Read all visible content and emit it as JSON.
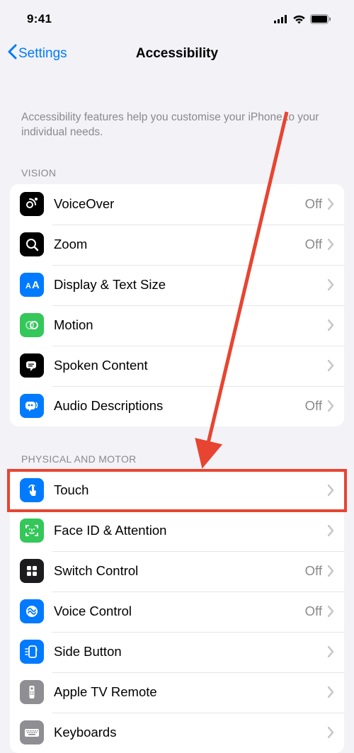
{
  "status": {
    "time": "9:41"
  },
  "nav": {
    "back_label": "Settings",
    "title": "Accessibility"
  },
  "intro": "Accessibility features help you customise your iPhone to your individual needs.",
  "sections": {
    "vision": {
      "header": "VISION",
      "items": [
        {
          "label": "VoiceOver",
          "value": "Off"
        },
        {
          "label": "Zoom",
          "value": "Off"
        },
        {
          "label": "Display & Text Size",
          "value": ""
        },
        {
          "label": "Motion",
          "value": ""
        },
        {
          "label": "Spoken Content",
          "value": ""
        },
        {
          "label": "Audio Descriptions",
          "value": "Off"
        }
      ]
    },
    "physical": {
      "header": "PHYSICAL AND MOTOR",
      "items": [
        {
          "label": "Touch",
          "value": ""
        },
        {
          "label": "Face ID & Attention",
          "value": ""
        },
        {
          "label": "Switch Control",
          "value": "Off"
        },
        {
          "label": "Voice Control",
          "value": "Off"
        },
        {
          "label": "Side Button",
          "value": ""
        },
        {
          "label": "Apple TV Remote",
          "value": ""
        },
        {
          "label": "Keyboards",
          "value": ""
        }
      ]
    }
  },
  "annotation": {
    "highlight_target": "touch-row",
    "arrow_color": "#e74531"
  }
}
